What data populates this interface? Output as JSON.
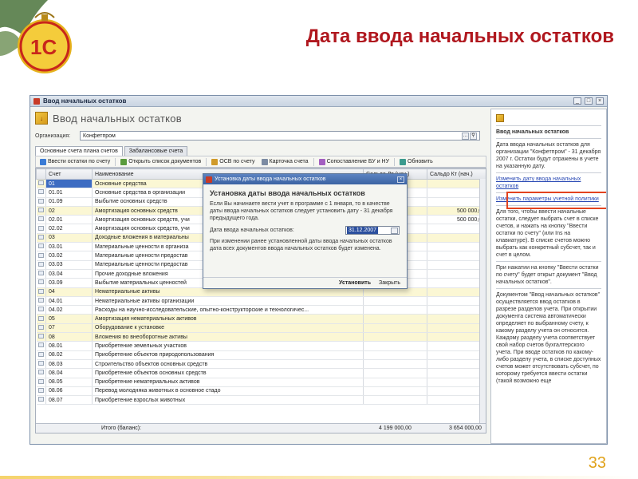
{
  "slide": {
    "title": "Дата ввода начальных остатков",
    "page_number": "33"
  },
  "window": {
    "title": "Ввод начальных остатков",
    "heading": "Ввод начальных остатков",
    "org_label": "Организация:",
    "org_value": "Конфетпром",
    "tabs": [
      "Основные счета плана счетов",
      "Забалансовые счета"
    ],
    "toolbar": [
      {
        "label": "Ввести остатки по счету",
        "icon": "enter-balance-icon"
      },
      {
        "label": "Открыть список документов",
        "icon": "documents-list-icon"
      },
      {
        "label": "ОСВ по счету",
        "icon": "report-icon"
      },
      {
        "label": "Карточка счета",
        "icon": "account-card-icon"
      },
      {
        "label": "Сопоставление БУ и НУ",
        "icon": "compare-icon"
      },
      {
        "label": "Обновить",
        "icon": "refresh-icon"
      }
    ],
    "columns": {
      "account": "Счет",
      "name": "Наименование",
      "debit": "Сальдо Дт (нач.)",
      "credit": "Сальдо Кт (нач.)"
    },
    "rows": [
      {
        "account": "01",
        "name": "Основные средства",
        "debit": "",
        "credit": "",
        "highlight": true,
        "selected": true
      },
      {
        "account": "01.01",
        "name": "Основные средства в организации",
        "debit": "",
        "credit": "",
        "highlight": false,
        "selected": false
      },
      {
        "account": "01.09",
        "name": "Выбытие основных средств",
        "debit": "",
        "credit": "",
        "highlight": false,
        "selected": false
      },
      {
        "account": "02",
        "name": "Амортизация основных средств",
        "debit": "",
        "credit": "500 000,00",
        "highlight": true,
        "selected": false
      },
      {
        "account": "02.01",
        "name": "Амортизация основных средств, учи",
        "debit": "",
        "credit": "500 000,00",
        "highlight": false,
        "selected": false
      },
      {
        "account": "02.02",
        "name": "Амортизация основных средств, учи",
        "debit": "",
        "credit": "",
        "highlight": false,
        "selected": false
      },
      {
        "account": "03",
        "name": "Доходные вложения в материальны",
        "debit": "",
        "credit": "",
        "highlight": true,
        "selected": false
      },
      {
        "account": "03.01",
        "name": "Материальные ценности в организа",
        "debit": "",
        "credit": "",
        "highlight": false,
        "selected": false
      },
      {
        "account": "03.02",
        "name": "Материальные ценности предостав",
        "debit": "",
        "credit": "",
        "highlight": false,
        "selected": false
      },
      {
        "account": "03.03",
        "name": "Материальные ценности предостав",
        "debit": "",
        "credit": "",
        "highlight": false,
        "selected": false
      },
      {
        "account": "03.04",
        "name": "Прочие доходные вложения",
        "debit": "",
        "credit": "",
        "highlight": false,
        "selected": false
      },
      {
        "account": "03.09",
        "name": "Выбытие материальных ценностей",
        "debit": "",
        "credit": "",
        "highlight": false,
        "selected": false
      },
      {
        "account": "04",
        "name": "Нематериальные активы",
        "debit": "",
        "credit": "",
        "highlight": true,
        "selected": false
      },
      {
        "account": "04.01",
        "name": "Нематериальные активы организации",
        "debit": "",
        "credit": "",
        "highlight": false,
        "selected": false
      },
      {
        "account": "04.02",
        "name": "Расходы на научно-исследовательские, опытно-конструкторские и технологичес...",
        "debit": "",
        "credit": "",
        "highlight": false,
        "selected": false
      },
      {
        "account": "05",
        "name": "Амортизация нематериальных активов",
        "debit": "",
        "credit": "",
        "highlight": true,
        "selected": false
      },
      {
        "account": "07",
        "name": "Оборудование к установке",
        "debit": "",
        "credit": "",
        "highlight": true,
        "selected": false
      },
      {
        "account": "08",
        "name": "Вложения во внеоборотные активы",
        "debit": "",
        "credit": "",
        "highlight": true,
        "selected": false
      },
      {
        "account": "08.01",
        "name": "Приобретение земельных участков",
        "debit": "",
        "credit": "",
        "highlight": false,
        "selected": false
      },
      {
        "account": "08.02",
        "name": "Приобретение объектов природопользования",
        "debit": "",
        "credit": "",
        "highlight": false,
        "selected": false
      },
      {
        "account": "08.03",
        "name": "Строительство объектов основных средств",
        "debit": "",
        "credit": "",
        "highlight": false,
        "selected": false
      },
      {
        "account": "08.04",
        "name": "Приобретение объектов основных средств",
        "debit": "",
        "credit": "",
        "highlight": false,
        "selected": false
      },
      {
        "account": "08.05",
        "name": "Приобретение нематериальных активов",
        "debit": "",
        "credit": "",
        "highlight": false,
        "selected": false
      },
      {
        "account": "08.06",
        "name": "Перевод молодняка животных в основное стадо",
        "debit": "",
        "credit": "",
        "highlight": false,
        "selected": false
      },
      {
        "account": "08.07",
        "name": "Приобретение взрослых животных",
        "debit": "",
        "credit": "",
        "highlight": false,
        "selected": false
      }
    ],
    "total": {
      "label": "Итого (баланс):",
      "debit": "4 199 000,00",
      "credit": "3 654 000,00"
    }
  },
  "dialog": {
    "title": "Установка даты ввода начальных остатков",
    "heading": "Установка даты ввода начальных остатков",
    "text1": "Если Вы начинаете вести учет в программе с 1 января, то в качестве даты ввода начальных остатков следует установить дату - 31 декабря предыдущего года.",
    "date_label": "Дата ввода начальных остатков:",
    "date_value": "31.12.2007",
    "text2": "При изменении ранее установленной даты ввода начальных остатков дата всех документов ввода начальных остатков будет изменена.",
    "ok_label": "Установить",
    "close_label": "Закрыть"
  },
  "right_pane": {
    "heading": "Ввод начальных остатков",
    "p1": "Дата ввода начальных остатков для организации \"Конфетпром\" - 31 декабря 2007 г. Остатки будут отражены в учете на указанную дату.",
    "link_change_date": "Изменить дату ввода начальных остатков",
    "link_change_params": "Изменить параметры учетной политики",
    "p2": "Для того, чтобы ввести начальные остатки, следует выбрать счет в списке счетов, и нажать на кнопку \"Ввести остатки по счету\" (или Ins на клавиатуре). В списке счетов можно выбрать как конкретный субсчет, так и счет в целом.",
    "p3": "При нажатии на кнопку \"Ввести остатки по счету\" будет открыт документ \"Ввод начальных остатков\".",
    "p4": "Документом \"Ввод начальных остатков\" осуществляется ввод остатков в разрезе разделов учета. При открытии документа система автоматически определяет по выбранному счету, к какому разделу учета он относится. Каждому разделу учета соответствует свой набор счетов бухгалтерского учета. При вводе остатков по какому-либо разделу учета, в списке доступных счетов может отсутствовать субсчет, по которому требуется ввести остатки (такой возможно еще"
  },
  "colors": {
    "title_red": "#b0171e",
    "page_number": "#e0a21a",
    "highlight_border": "#e2431f",
    "dialog_title_blue": "#3b63a3",
    "row_highlight": "#fbf7d4"
  }
}
